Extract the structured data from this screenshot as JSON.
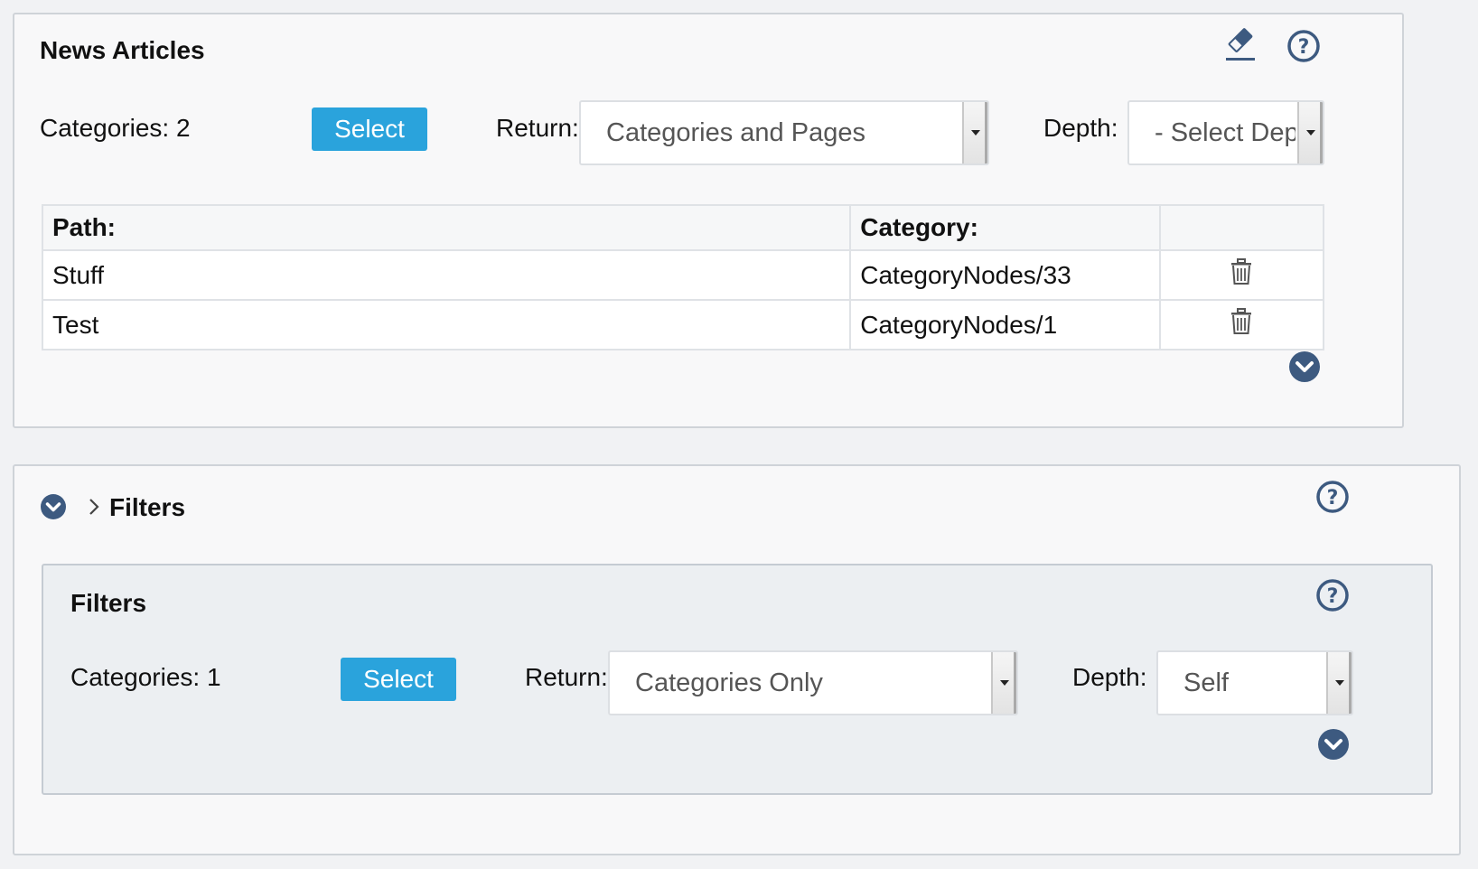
{
  "news_panel": {
    "title": "News Articles",
    "categories_label": "Categories: 2",
    "select_label": "Select",
    "return_label": "Return:",
    "return_value": "Categories and Pages",
    "depth_label": "Depth:",
    "depth_value": "- Select Depth -",
    "table": {
      "headers": [
        "Path:",
        "Category:",
        ""
      ],
      "rows": [
        {
          "path": "Stuff",
          "category": "CategoryNodes/33"
        },
        {
          "path": "Test",
          "category": "CategoryNodes/1"
        }
      ]
    }
  },
  "filters_panel": {
    "title": "Filters",
    "inner": {
      "title": "Filters",
      "categories_label": "Categories: 1",
      "select_label": "Select",
      "return_label": "Return:",
      "return_value": "Categories Only",
      "depth_label": "Depth:",
      "depth_value": "Self"
    }
  },
  "icons": {
    "eraser": "eraser-icon",
    "help": "help-circle-icon",
    "expand": "chevron-down-circle-icon",
    "trash": "trash-icon",
    "breadcrumb": "chevron-right-icon"
  },
  "colors": {
    "accent": "#2aa3dc",
    "icon": "#3d5a80"
  }
}
